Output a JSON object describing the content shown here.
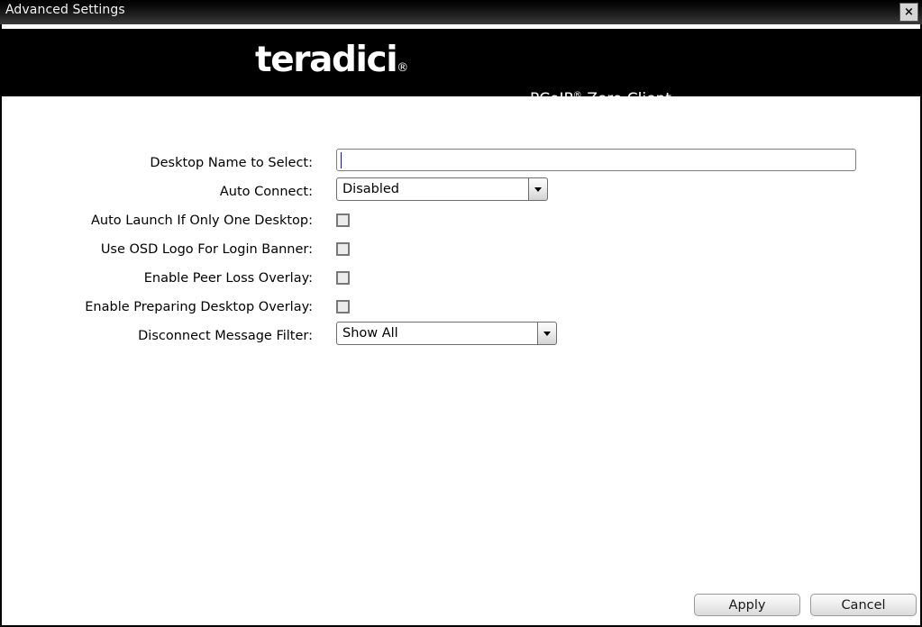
{
  "window": {
    "title": "Advanced Settings",
    "close_label": "×",
    "close_icon": "close-icon"
  },
  "banner": {
    "logo_text": "teradici",
    "logo_mark": "®",
    "product_name": "PCoIP",
    "product_mark": "®",
    "product_suffix": " Zero Client"
  },
  "form": {
    "rows": [
      {
        "label": "Desktop Name to Select:",
        "type": "text",
        "name": "desktop-name-to-select",
        "value": "",
        "placeholder": ""
      },
      {
        "label": "Auto Connect:",
        "type": "select",
        "name": "auto-connect",
        "value": "Disabled"
      },
      {
        "label": "Auto Launch If Only One Desktop:",
        "type": "checkbox",
        "name": "auto-launch-if-only-one-desktop",
        "checked": false
      },
      {
        "label": "Use OSD Logo For Login Banner:",
        "type": "checkbox",
        "name": "use-osd-logo-for-login-banner",
        "checked": false
      },
      {
        "label": "Enable Peer Loss Overlay:",
        "type": "checkbox",
        "name": "enable-peer-loss-overlay",
        "checked": false
      },
      {
        "label": "Enable Preparing Desktop Overlay:",
        "type": "checkbox",
        "name": "enable-preparing-desktop-overlay",
        "checked": false
      },
      {
        "label": "Disconnect Message Filter:",
        "type": "select",
        "name": "disconnect-message-filter",
        "value": "Show All"
      }
    ]
  },
  "footer": {
    "apply_label": "Apply",
    "cancel_label": "Cancel"
  },
  "colors": {
    "banner_background": "#000000",
    "titlebar_top": "#000000",
    "titlebar_bottom": "#3c3c3c",
    "caret": "#1515d0",
    "checkbox_border": "#787878",
    "checkbox_fill": "#ececec"
  }
}
